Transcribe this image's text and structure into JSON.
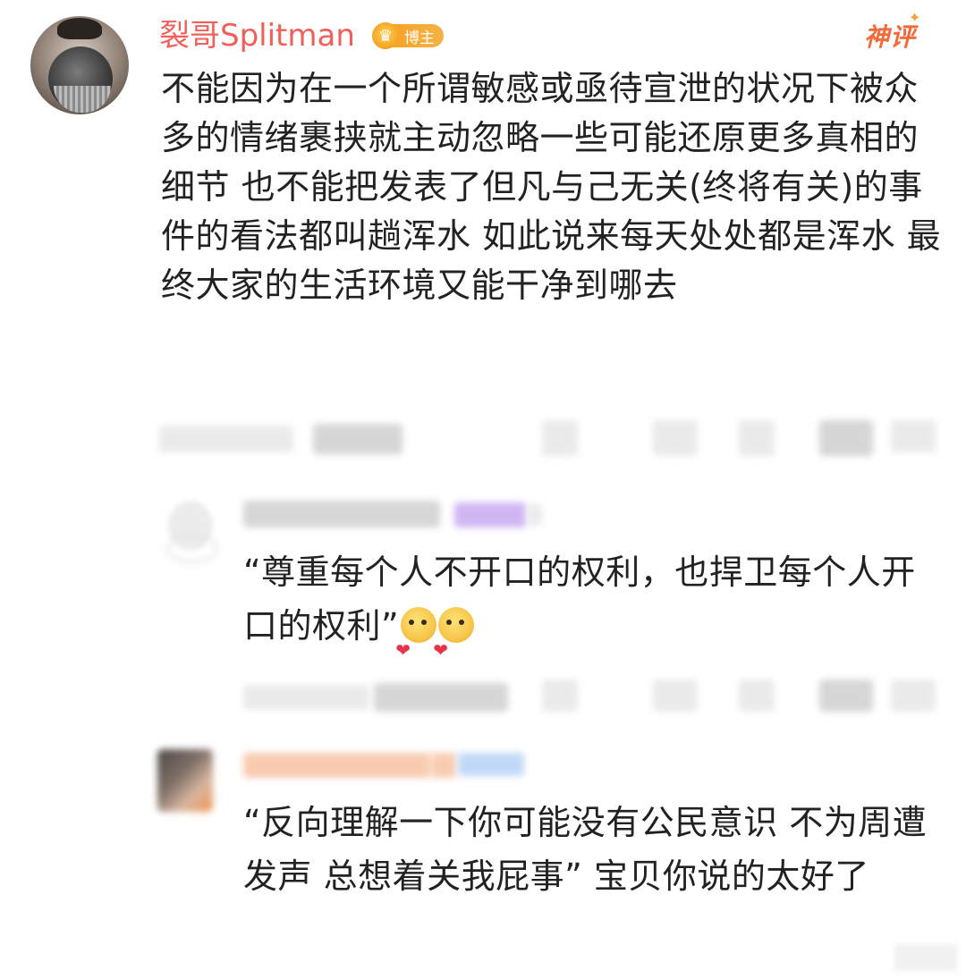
{
  "main_comment": {
    "username": "裂哥Splitman",
    "badge_label": "博主",
    "badge_icon": "crown-icon",
    "hot_label": "神评",
    "text": "不能因为在一个所谓敏感或亟待宣泄的状况下被众多的情绪裹挟就主动忽略一些可能还原更多真相的细节 也不能把发表了但凡与己无关(终将有关)的事件的看法都叫趟浑水 如此说来每天处处都是浑水 最终大家的生活环境又能干净到哪去"
  },
  "replies": [
    {
      "text": "“尊重每个人不开口的权利，也捍卫每个人开口的权利”",
      "emojis": [
        "blush-heart-emoji",
        "blush-heart-emoji"
      ]
    },
    {
      "text": "“反向理解一下你可能没有公民意识 不为周遭发声 总想着关我屁事” 宝贝你说的太好了"
    }
  ],
  "colors": {
    "username": "#f0605a",
    "badge": "#f7a224",
    "hot_tag": "#f36a3a",
    "text": "#222222",
    "background": "#ffffff"
  }
}
